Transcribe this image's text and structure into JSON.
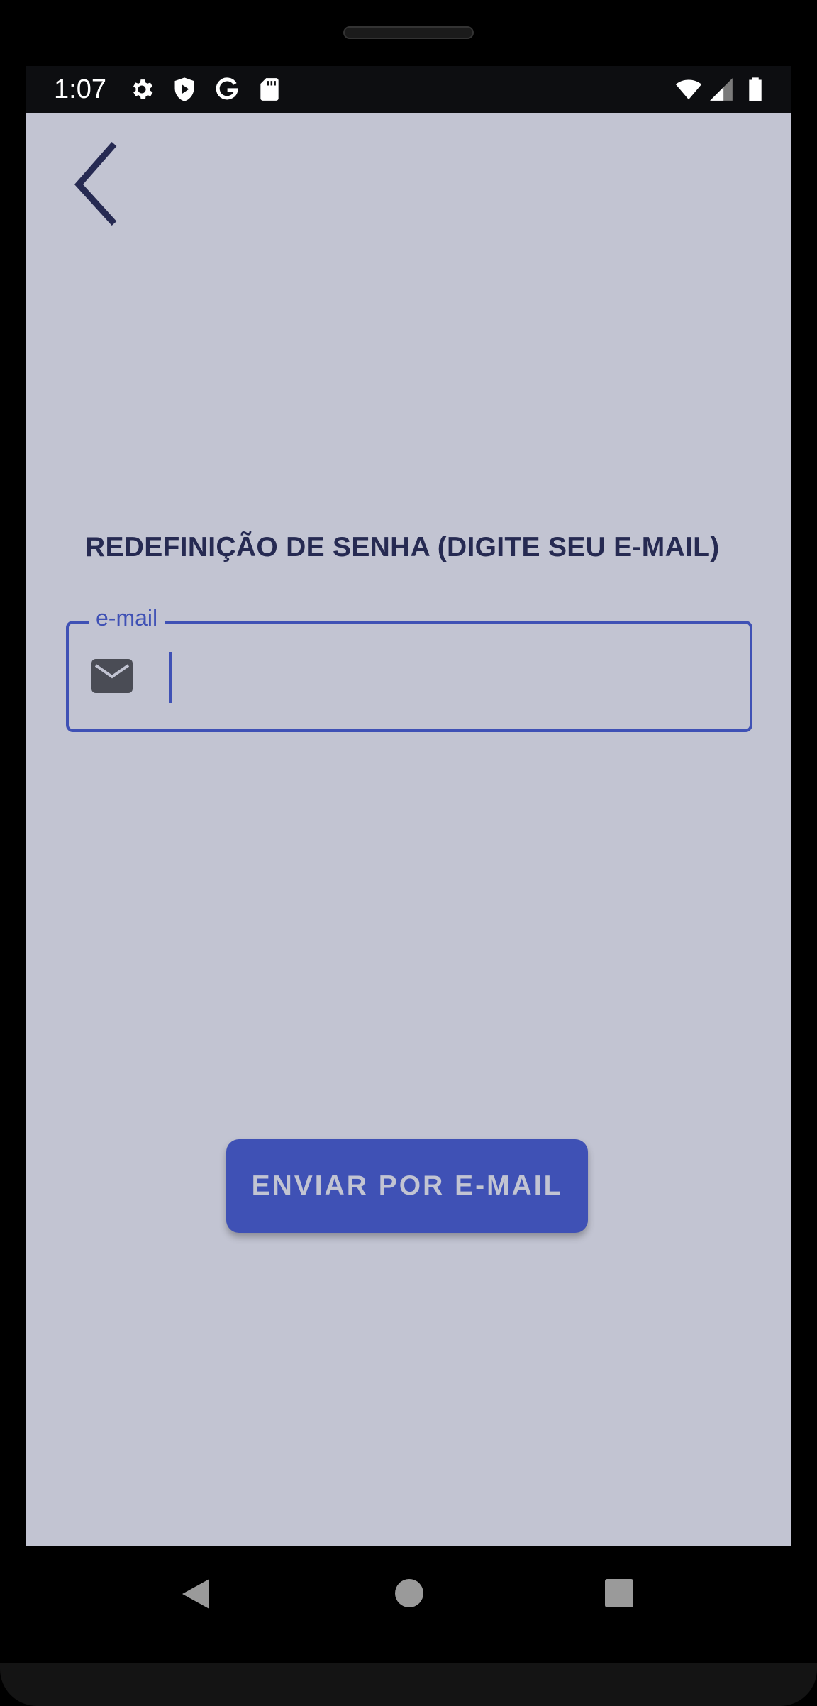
{
  "status_bar": {
    "time": "1:07",
    "left_icons": [
      "gear-icon",
      "shield-play-icon",
      "google-g-icon",
      "sd-card-icon"
    ],
    "right_icons": [
      "wifi-icon",
      "cellular-signal-icon",
      "battery-icon"
    ]
  },
  "header": {
    "back_icon": "chevron-left-icon"
  },
  "main": {
    "title": "REDEFINIÇÃO DE SENHA (DIGITE SEU E-MAIL)",
    "email_field": {
      "label": "e-mail",
      "value": "",
      "icon": "mail-icon"
    },
    "send_button_label": "ENVIAR POR E-MAIL"
  },
  "nav_bar": {
    "buttons": [
      "back-triangle-icon",
      "home-circle-icon",
      "recents-square-icon"
    ]
  },
  "colors": {
    "background": "#c2c4d2",
    "accent": "#3f51b5",
    "title_text": "#262a52",
    "status_bar": "#0d0e11"
  }
}
